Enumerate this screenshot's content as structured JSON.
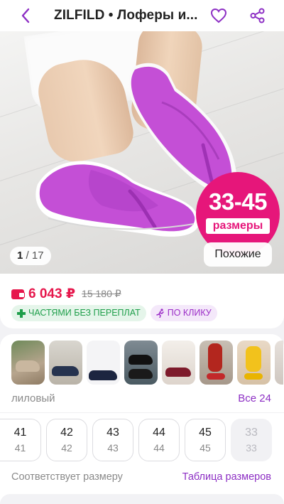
{
  "header": {
    "title": "ZILFILD • Лоферы и...",
    "back_icon": "chevron-left-icon",
    "favorite_icon": "heart-icon",
    "share_icon": "share-icon"
  },
  "gallery": {
    "current": "1",
    "separator": " / ",
    "total": "17",
    "size_badge": {
      "range": "33-45",
      "label": "размеры"
    },
    "similar_label": "Похожие"
  },
  "price": {
    "current": "6 043 ₽",
    "old": "15 180 ₽",
    "chips": [
      {
        "label": "ЧАСТЯМИ БЕЗ ПЕРЕПЛАТ",
        "icon": "plus-cross-icon"
      },
      {
        "label": "ПО КЛИКУ",
        "icon": "running-man-icon"
      }
    ]
  },
  "colors": {
    "selected": "лиловый",
    "all_link": "Все 24",
    "thumbnails": [
      "beige",
      "navy",
      "black-navy",
      "black",
      "burgundy",
      "red",
      "yellow",
      "partial"
    ]
  },
  "sizes": {
    "items": [
      {
        "eu": "41",
        "ru": "41",
        "available": true
      },
      {
        "eu": "42",
        "ru": "42",
        "available": true
      },
      {
        "eu": "43",
        "ru": "43",
        "available": true
      },
      {
        "eu": "44",
        "ru": "44",
        "available": true
      },
      {
        "eu": "45",
        "ru": "45",
        "available": true
      },
      {
        "eu": "33",
        "ru": "33",
        "available": false
      }
    ],
    "fit_text": "Соответствует размеру",
    "table_link": "Таблица размеров"
  },
  "colors_palette": {
    "accent": "#8d2fc4",
    "price": "#e6174c",
    "badge": "#e6167a",
    "shoe": "#c44fd6"
  }
}
